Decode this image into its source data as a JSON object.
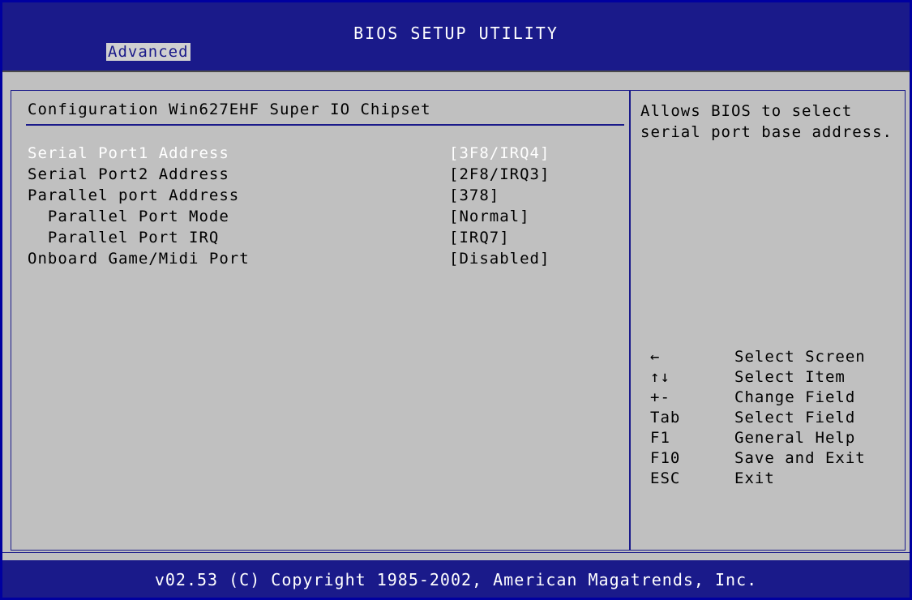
{
  "header": {
    "title": "BIOS SETUP UTILITY",
    "active_tab": "Advanced"
  },
  "section": {
    "title": "Configuration Win627EHF Super IO Chipset"
  },
  "options": [
    {
      "label": "Serial Port1 Address",
      "value": "[3F8/IRQ4]",
      "selected": true
    },
    {
      "label": "Serial Port2 Address",
      "value": "[2F8/IRQ3]",
      "selected": false
    },
    {
      "label": "Parallel port Address",
      "value": "[378]",
      "selected": false
    },
    {
      "label": "  Parallel Port Mode",
      "value": "[Normal]",
      "selected": false
    },
    {
      "label": "  Parallel Port IRQ",
      "value": "[IRQ7]",
      "selected": false
    },
    {
      "label": "Onboard Game/Midi Port",
      "value": "[Disabled]",
      "selected": false
    }
  ],
  "help": {
    "text": "Allows BIOS to select serial port base address."
  },
  "keys": [
    {
      "key": "←",
      "desc": "Select Screen"
    },
    {
      "key": "↑↓",
      "desc": "Select Item"
    },
    {
      "key": "+-",
      "desc": "Change Field"
    },
    {
      "key": "Tab",
      "desc": "Select Field"
    },
    {
      "key": "F1",
      "desc": "General Help"
    },
    {
      "key": "F10",
      "desc": "Save and Exit"
    },
    {
      "key": "ESC",
      "desc": "Exit"
    }
  ],
  "footer": {
    "copyright": "v02.53 (C) Copyright 1985-2002, American Magatrends, Inc."
  },
  "colors": {
    "frame": "#1a1a8a",
    "panel": "#c0c0c0",
    "selected_text": "#ffffff"
  }
}
